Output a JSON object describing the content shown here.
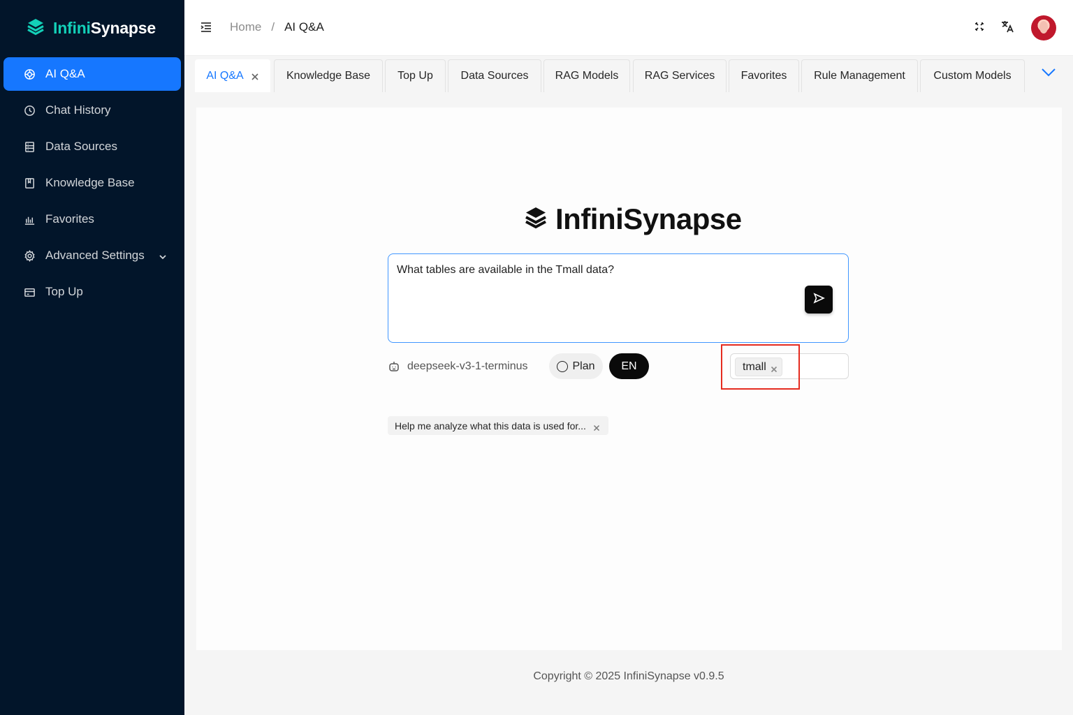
{
  "app": {
    "brand_part1": "Infini",
    "brand_part2": "Synapse",
    "brand_full": "InfiniSynapse"
  },
  "sidebar": {
    "items": [
      {
        "label": "AI Q&A",
        "icon": "ai-chat-icon",
        "active": true
      },
      {
        "label": "Chat History",
        "icon": "history-icon"
      },
      {
        "label": "Data Sources",
        "icon": "database-icon"
      },
      {
        "label": "Knowledge Base",
        "icon": "book-icon"
      },
      {
        "label": "Favorites",
        "icon": "bar-chart-icon"
      },
      {
        "label": "Advanced Settings",
        "icon": "gear-icon",
        "expandable": true
      },
      {
        "label": "Top Up",
        "icon": "wallet-icon"
      }
    ]
  },
  "header": {
    "breadcrumb_home": "Home",
    "breadcrumb_sep": "/",
    "breadcrumb_current": "AI Q&A"
  },
  "tabs": [
    {
      "label": "AI Q&A",
      "active": true,
      "closable": true
    },
    {
      "label": "Knowledge Base"
    },
    {
      "label": "Top Up"
    },
    {
      "label": "Data Sources"
    },
    {
      "label": "RAG Models"
    },
    {
      "label": "RAG Services"
    },
    {
      "label": "Favorites"
    },
    {
      "label": "Rule Management"
    },
    {
      "label": "Custom Models"
    }
  ],
  "main": {
    "prompt_value": "What tables are available in the Tmall data?",
    "model_name": "deepseek-v3-1-terminus",
    "plan_label": "Plan",
    "lang_label": "EN",
    "selected_tag": "tmall",
    "suggestion": "Help me analyze what this data is used for..."
  },
  "footer": {
    "copyright": "Copyright © 2025 InfiniSynapse v0.9.5"
  },
  "colors": {
    "sidebar_bg": "#02152a",
    "accent": "#1677ff",
    "brand_teal": "#13d0b8",
    "highlight": "#e52b1f"
  }
}
